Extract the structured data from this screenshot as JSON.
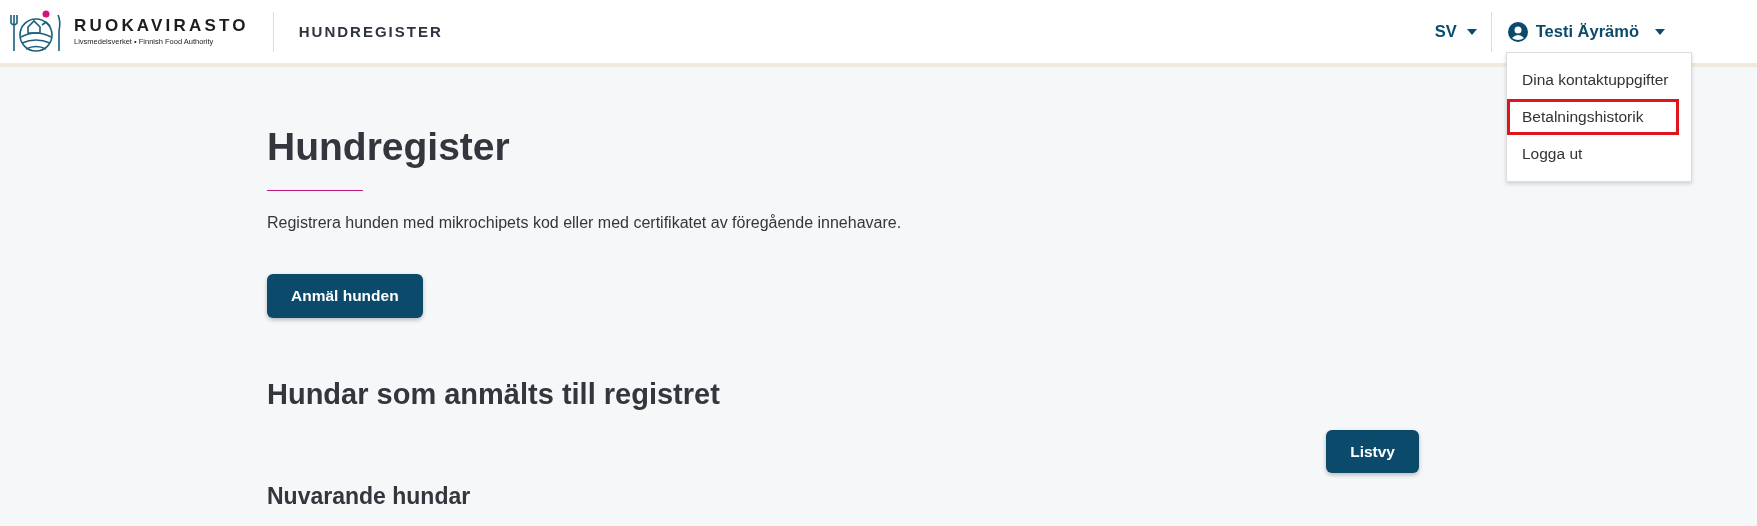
{
  "header": {
    "logo": {
      "name": "RUOKAVIRASTO",
      "tagline": "Livsmedelsverket • Finnish Food Authority"
    },
    "service": "HUNDREGISTER",
    "language": "SV",
    "user": "Testi Äyrämö",
    "user_menu": {
      "expanded": true,
      "items": [
        {
          "label": "Dina kontaktuppgifter",
          "highlighted": false
        },
        {
          "label": "Betalningshistorik",
          "highlighted": true
        },
        {
          "label": "Logga ut",
          "highlighted": false
        }
      ]
    }
  },
  "main": {
    "title": "Hundregister",
    "intro": "Registrera hunden med mikrochipets kod eller med certifikatet av föregående innehavare.",
    "register_button": "Anmäl hunden",
    "section_title": "Hundar som anmälts till registret",
    "view_button": "Listvy",
    "subsection_title": "Nuvarande hundar"
  }
}
